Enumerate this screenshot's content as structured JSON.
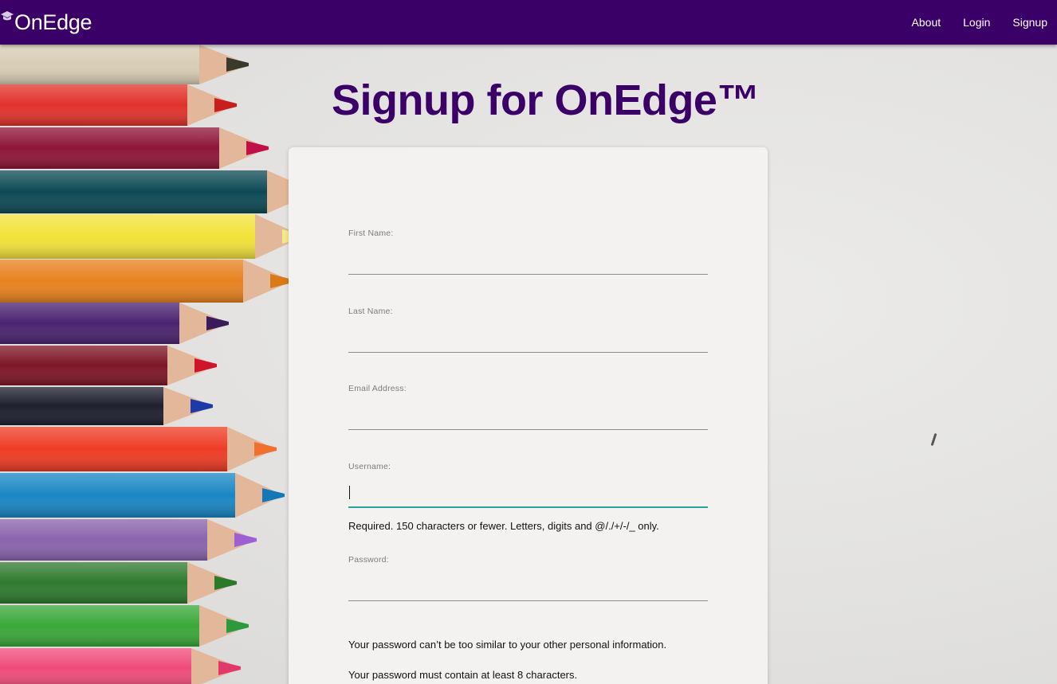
{
  "navbar": {
    "brand": "OnEdge",
    "links": [
      "About",
      "Login",
      "Signup"
    ]
  },
  "page_title": "Signup for OnEdge™",
  "form": {
    "first_name_label": "First Name:",
    "last_name_label": "Last Name:",
    "email_label": "Email Address:",
    "username_label": "Username:",
    "username_help": "Required. 150 characters or fewer. Letters, digits and @/./+/-/_ only.",
    "password_label": "Password:",
    "password_help_1": "Your password can’t be too similar to your other personal information.",
    "password_help_2": "Your password must contain at least 8 characters."
  },
  "colors": {
    "navbar": "#3a0068",
    "title": "#3a0068",
    "focus_underline": "#26a69a"
  }
}
